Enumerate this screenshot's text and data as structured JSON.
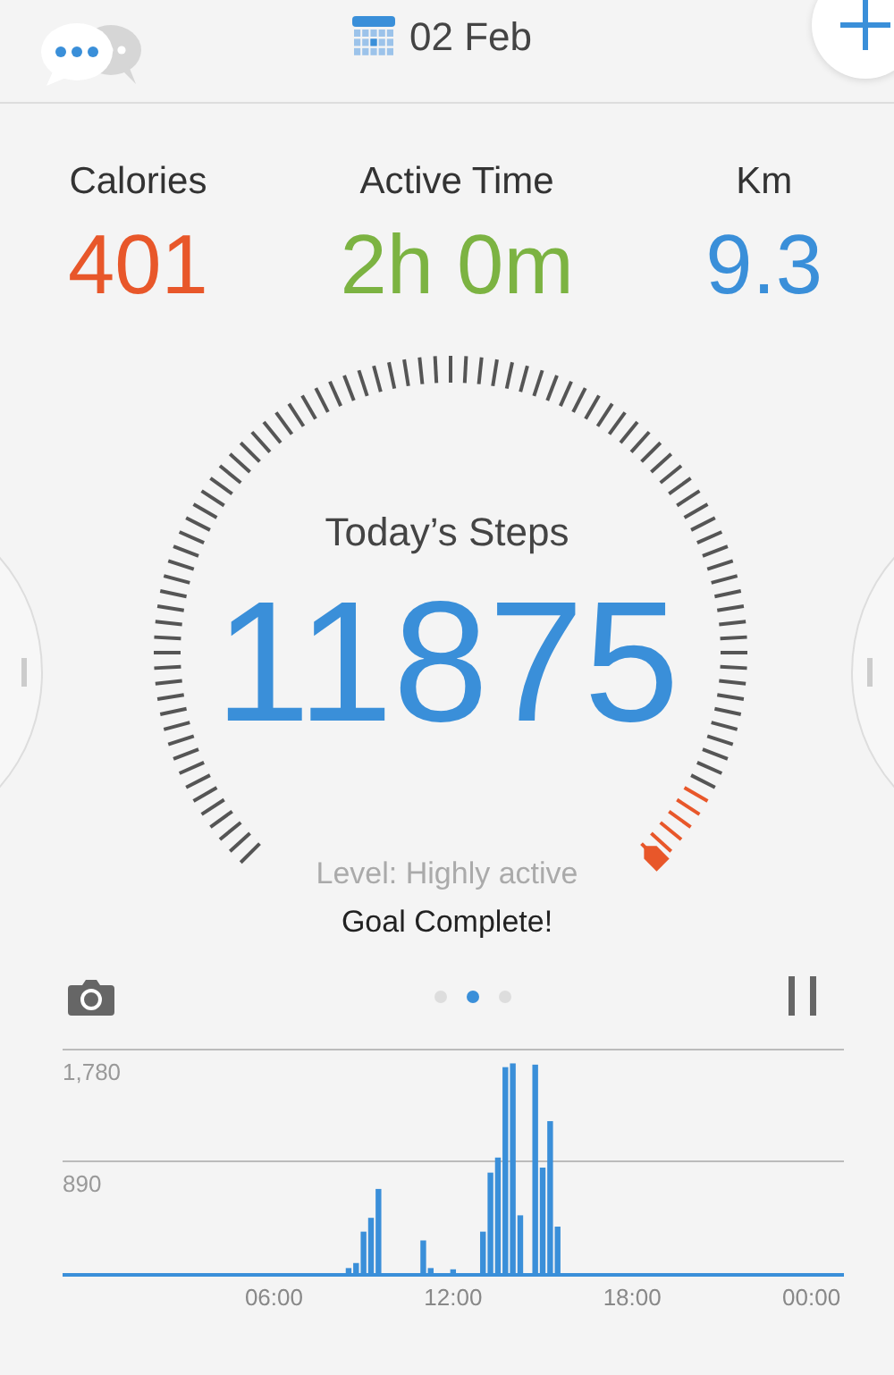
{
  "header": {
    "date": "02 Feb"
  },
  "stats": [
    {
      "label": "Calories",
      "value": "401",
      "color": "#e8572a"
    },
    {
      "label": "Active Time",
      "value": "2h 0m",
      "color": "#7cb342"
    },
    {
      "label": "Km",
      "value": "9.3",
      "color": "#3a8fd9"
    }
  ],
  "gauge": {
    "title": "Today’s Steps",
    "steps": "11875",
    "activity": "Level: Highly active",
    "status": "Goal Complete!"
  },
  "pages": [
    {
      "selected": false
    },
    {
      "selected": true
    },
    {
      "selected": false
    }
  ],
  "chart": {
    "chart_data": {
      "type": "bar",
      "x": [
        8.5,
        8.75,
        9,
        9.25,
        9.5,
        11,
        11.25,
        12,
        13,
        13.25,
        13.5,
        13.75,
        14,
        14.25,
        14.75,
        15,
        15.25,
        15.5
      ],
      "values": [
        40,
        80,
        330,
        440,
        670,
        260,
        40,
        30,
        330,
        800,
        920,
        1640,
        1670,
        460,
        1660,
        840,
        1210,
        370
      ],
      "xlim": [
        -1.08,
        25.09
      ],
      "ylim": [
        0,
        1780
      ],
      "xticks": [
        {
          "value": 6,
          "label": "06:00"
        },
        {
          "value": 12,
          "label": "12:00"
        },
        {
          "value": 18,
          "label": "18:00"
        },
        {
          "value": 24,
          "label": "00:00"
        }
      ],
      "yticks": [
        {
          "value": 890,
          "label": "890"
        },
        {
          "value": 1780,
          "label": "1,780"
        }
      ]
    }
  }
}
